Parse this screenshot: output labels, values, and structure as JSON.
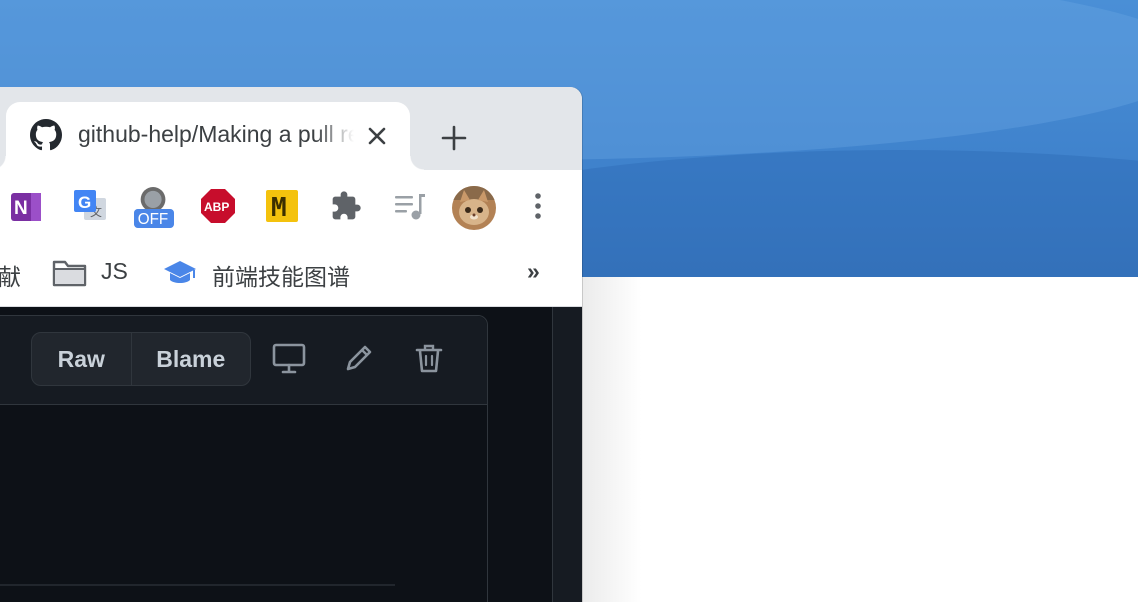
{
  "browser": {
    "tab": {
      "title": "github-help/Making a pull request",
      "favicon": "github-icon",
      "close": "close-icon"
    },
    "new_tab": "plus-icon",
    "extensions": [
      {
        "name": "onenote-icon",
        "label": "N"
      },
      {
        "name": "google-translate-icon",
        "label": "G"
      },
      {
        "name": "off-extension-icon",
        "label": "OFF"
      },
      {
        "name": "adblock-plus-icon",
        "label": "ABP"
      },
      {
        "name": "m-extension-icon",
        "label": "M"
      },
      {
        "name": "extensions-puzzle-icon",
        "label": ""
      },
      {
        "name": "media-control-icon",
        "label": ""
      },
      {
        "name": "profile-avatar",
        "label": ""
      },
      {
        "name": "more-menu-icon",
        "label": ""
      }
    ],
    "bookmarks": {
      "partial_item": "献",
      "folder_label": "JS",
      "roadmap_label": "前端技能图谱",
      "overflow": "»"
    }
  },
  "github": {
    "raw_label": "Raw",
    "blame_label": "Blame"
  },
  "colors": {
    "wallpaper": "#3f82cc",
    "github_bg": "#0d1117",
    "github_header": "#161b22"
  }
}
